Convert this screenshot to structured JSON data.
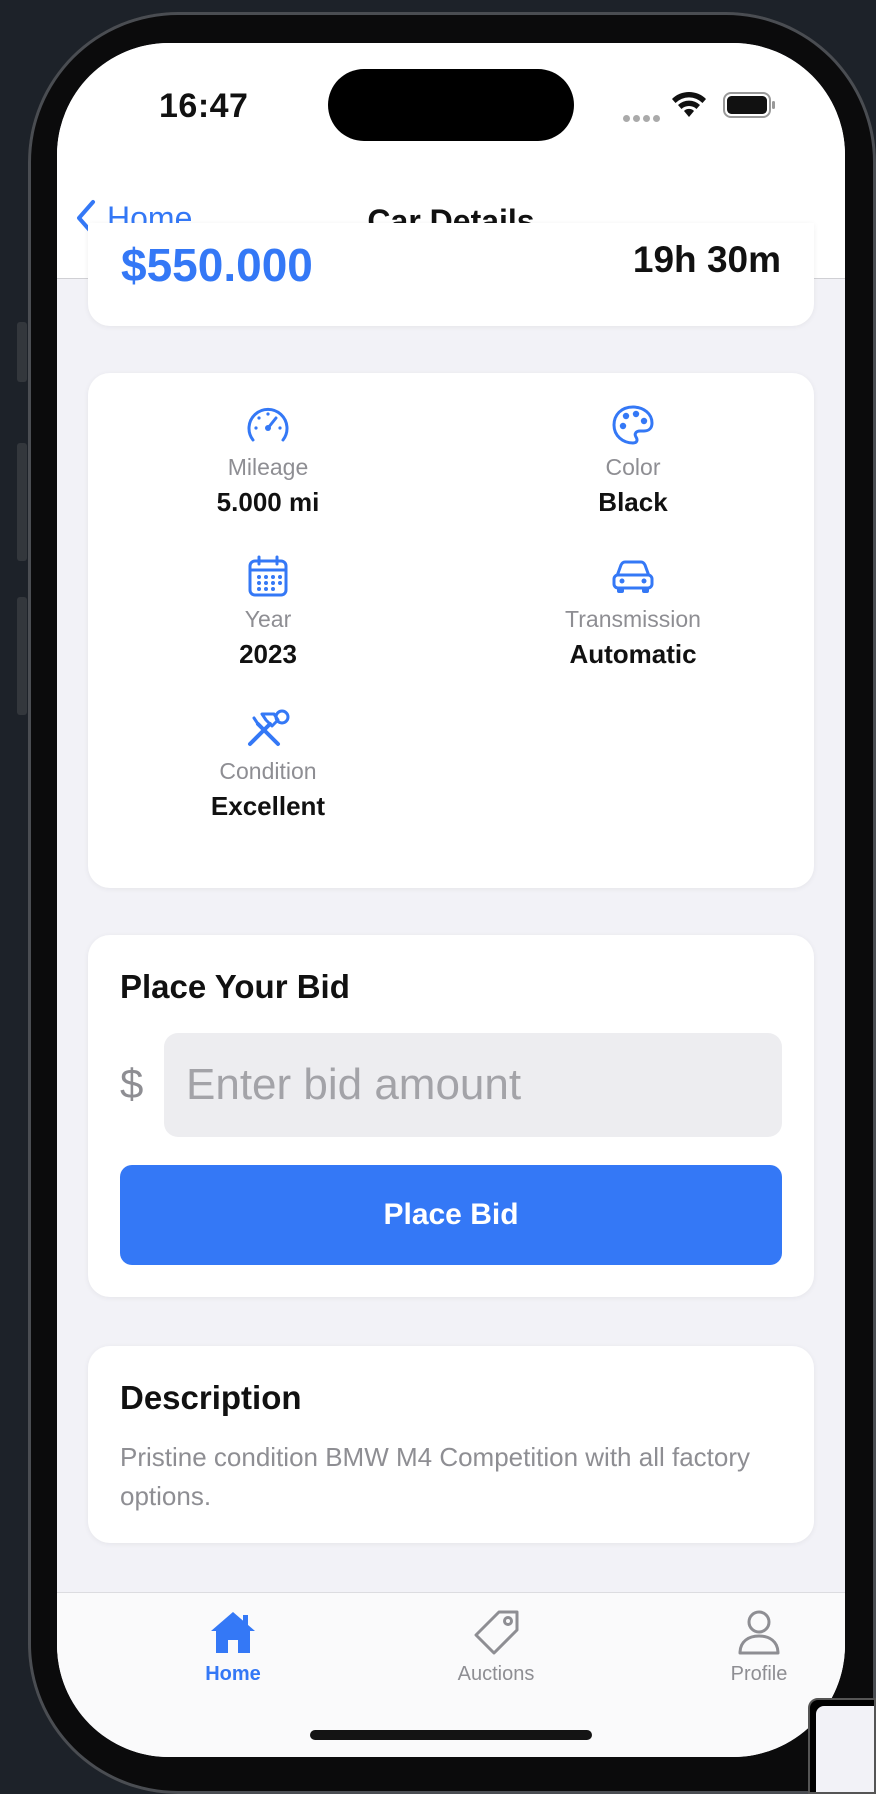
{
  "status_bar": {
    "time": "16:47"
  },
  "nav": {
    "back_label": "Home",
    "title": "Car Details"
  },
  "summary": {
    "price": "$550.000",
    "time_left": "19h 30m"
  },
  "specs": [
    {
      "icon": "speedometer-icon",
      "label": "Mileage",
      "value": "5.000 mi"
    },
    {
      "icon": "palette-icon",
      "label": "Color",
      "value": "Black"
    },
    {
      "icon": "calendar-icon",
      "label": "Year",
      "value": "2023"
    },
    {
      "icon": "car-icon",
      "label": "Transmission",
      "value": "Automatic"
    },
    {
      "icon": "tools-icon",
      "label": "Condition",
      "value": "Excellent"
    }
  ],
  "bid": {
    "title": "Place Your Bid",
    "currency": "$",
    "placeholder": "Enter bid amount",
    "button": "Place Bid"
  },
  "description": {
    "title": "Description",
    "text": "Pristine condition BMW M4 Competition with all factory options."
  },
  "tabs": [
    {
      "icon": "house-icon",
      "label": "Home",
      "active": true
    },
    {
      "icon": "tag-icon",
      "label": "Auctions",
      "active": false
    },
    {
      "icon": "person-icon",
      "label": "Profile",
      "active": false
    }
  ],
  "colors": {
    "accent": "#3478f6",
    "secondary_text": "#8e8e93",
    "background": "#f2f2f7"
  }
}
